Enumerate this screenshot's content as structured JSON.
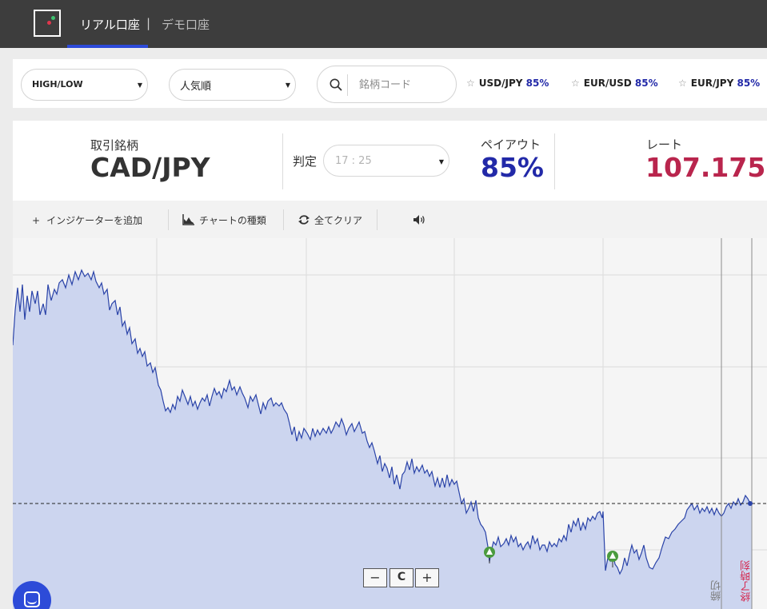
{
  "nav": {
    "tab_real": "リアル口座",
    "separator": "|",
    "tab_demo": "デモ口座"
  },
  "filters": {
    "type_select": "HIGH/LOW",
    "order_select": "人気順",
    "search_placeholder": "銘柄コード",
    "favorites": [
      {
        "pair": "USD/JPY",
        "payout": "85%"
      },
      {
        "pair": "EUR/USD",
        "payout": "85%"
      },
      {
        "pair": "EUR/JPY",
        "payout": "85%"
      }
    ]
  },
  "info": {
    "symbol_label": "取引銘柄",
    "symbol": "CAD/JPY",
    "expiry_label": "判定",
    "expiry_value": "17 : 25",
    "payout_label": "ペイアウト",
    "payout": "85%",
    "rate_label": "レート",
    "rate": "107.175"
  },
  "toolbar": {
    "add_indicator": "インジケーターを追加",
    "chart_type": "チャートの種類",
    "clear_all": "全てクリア"
  },
  "chart": {
    "cutoff_label": "締切",
    "expiry_time_label": "終了時刻",
    "zoom_out": "−",
    "zoom_reset": "C",
    "zoom_in": "+"
  },
  "colors": {
    "nav_bg": "#3d3d3d",
    "accent_blue": "#2c49d8",
    "payout_blue": "#2229a8",
    "rate_red": "#b9254d",
    "area_fill": "#ccd5ef",
    "line": "#2a43a8"
  },
  "icons": [
    "search-icon",
    "star-icon",
    "plus-icon",
    "chart-type-icon",
    "refresh-icon",
    "sound-icon",
    "chat-icon",
    "up-arrow-marker"
  ]
}
